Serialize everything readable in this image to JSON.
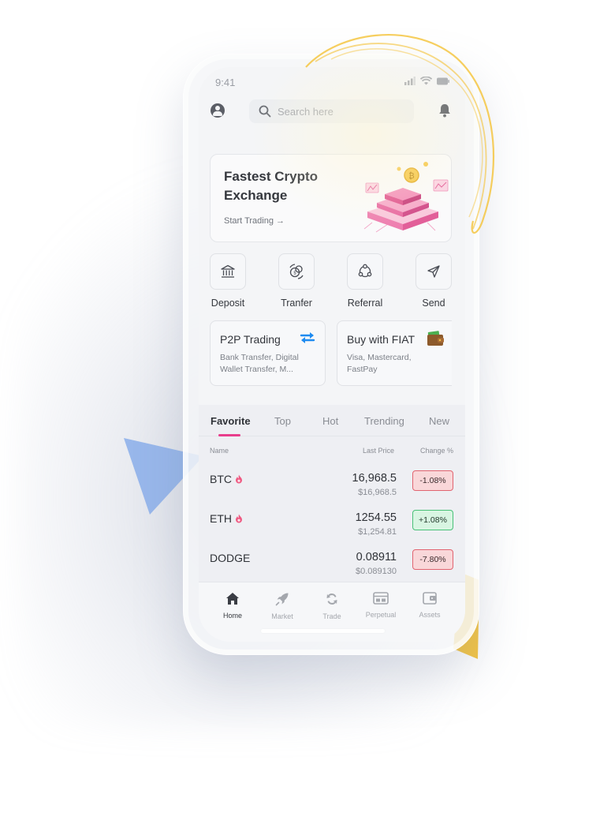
{
  "status_bar": {
    "time": "9:41"
  },
  "search": {
    "placeholder": "Search here"
  },
  "banner": {
    "title": "Fastest Crypto Exchange",
    "cta": "Start Trading →"
  },
  "actions": [
    {
      "label": "Deposit",
      "icon": "bank-icon"
    },
    {
      "label": "Tranfer",
      "icon": "coin-exchange-icon"
    },
    {
      "label": "Referral",
      "icon": "referral-icon"
    },
    {
      "label": "Send",
      "icon": "send-icon"
    }
  ],
  "cards": [
    {
      "title": "P2P Trading",
      "desc": "Bank Transfer, Digital Wallet Transfer, M...",
      "icon": "swap-arrows-icon"
    },
    {
      "title": "Buy with FIAT",
      "desc": "Visa, Mastercard, FastPay",
      "icon": "wallet-icon"
    }
  ],
  "market": {
    "tabs": [
      "Favorite",
      "Top",
      "Hot",
      "Trending",
      "New"
    ],
    "active_tab": "Favorite",
    "headers": {
      "name": "Name",
      "last_price": "Last Price",
      "change": "Change %"
    },
    "rows": [
      {
        "symbol": "BTC",
        "hot": true,
        "price": "16,968.5",
        "usd": "$16,968.5",
        "change": "-1.08%",
        "direction": "down"
      },
      {
        "symbol": "ETH",
        "hot": true,
        "price": "1254.55",
        "usd": "$1,254.81",
        "change": "+1.08%",
        "direction": "up"
      },
      {
        "symbol": "DODGE",
        "hot": false,
        "price": "0.08911",
        "usd": "$0.089130",
        "change": "-7.80%",
        "direction": "down"
      }
    ]
  },
  "bottom_nav": [
    {
      "label": "Home",
      "icon": "home-icon",
      "active": true
    },
    {
      "label": "Market",
      "icon": "rocket-icon",
      "active": false
    },
    {
      "label": "Trade",
      "icon": "trade-icon",
      "active": false
    },
    {
      "label": "Perpetual",
      "icon": "perpetual-icon",
      "active": false
    },
    {
      "label": "Assets",
      "icon": "wallet-icon",
      "active": false
    }
  ],
  "colors": {
    "accent": "#e83e8c",
    "negative": "#e16470",
    "positive": "#49c178",
    "decor_yellow": "#f5c542",
    "decor_blue": "#8fb1ea"
  }
}
